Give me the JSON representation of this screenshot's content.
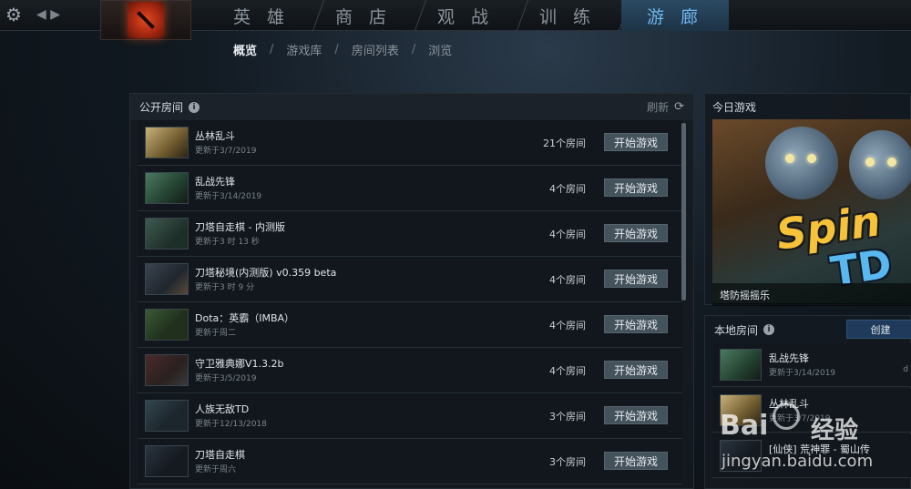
{
  "nav": {
    "tabs": [
      {
        "label": "英 雄"
      },
      {
        "label": "商 店"
      },
      {
        "label": "观 战"
      },
      {
        "label": "训 练"
      },
      {
        "label": "游 廊"
      }
    ]
  },
  "subnav": {
    "items": [
      "概览",
      "游戏库",
      "房间列表",
      "浏览"
    ],
    "separator": "/"
  },
  "public_rooms": {
    "title": "公开房间",
    "refresh": "刷新",
    "button_label": "开始游戏",
    "rows": [
      {
        "name": "丛林乱斗",
        "updated": "更新于3/7/2019",
        "count": "21个房间"
      },
      {
        "name": "乱战先锋",
        "updated": "更新于3/14/2019",
        "count": "4个房间"
      },
      {
        "name": "刀塔自走棋 - 内测版",
        "updated": "更新于3 时 13 秒",
        "count": "4个房间"
      },
      {
        "name": "刀塔秘境(内测版) v0.359 beta",
        "updated": "更新于3 时 9 分",
        "count": "4个房间"
      },
      {
        "name": "Dota：英霸（IMBA）",
        "updated": "更新于周二",
        "count": "4个房间"
      },
      {
        "name": "守卫雅典娜V1.3.2b",
        "updated": "更新于3/5/2019",
        "count": "4个房间"
      },
      {
        "name": "人族无敌TD",
        "updated": "更新于12/13/2018",
        "count": "3个房间"
      },
      {
        "name": "刀塔自走棋",
        "updated": "更新于周六",
        "count": "3个房间"
      }
    ]
  },
  "today_game": {
    "title": "今日游戏",
    "caption": "塔防摇摇乐",
    "art_line1": "Spin",
    "art_line2": "TD"
  },
  "local_rooms": {
    "title": "本地房间",
    "create": "创建",
    "rows": [
      {
        "name": "乱战先锋",
        "updated": "更新于3/14/2019",
        "trail": "d"
      },
      {
        "name": "丛林乱斗",
        "updated": "更新于3/7/2019",
        "trail": ""
      },
      {
        "name": "[仙侠] 荒神罪 - 蜀山传",
        "updated": "",
        "trail": ""
      }
    ]
  },
  "watermark": {
    "brand": "Bai",
    "brand_cn": "经验",
    "url": "jingyan.baidu.com"
  }
}
